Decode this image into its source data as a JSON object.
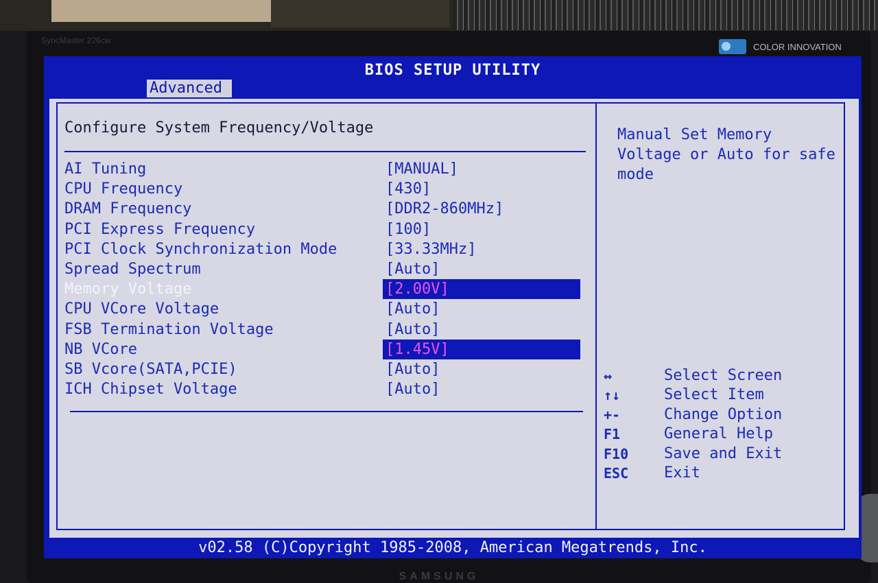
{
  "monitor": {
    "model": "SyncMaster 226cw",
    "badge": "COLOR INNOVATION",
    "brand": "SAMSUNG"
  },
  "bios": {
    "title": "BIOS SETUP UTILITY",
    "active_tab": "Advanced",
    "heading": "Configure System Frequency/Voltage",
    "settings": [
      {
        "label": "AI Tuning",
        "value": "[MANUAL]"
      },
      {
        "label": "CPU Frequency",
        "value": "[430]"
      },
      {
        "label": "DRAM Frequency",
        "value": "[DDR2-860MHz]"
      },
      {
        "label": "PCI Express Frequency",
        "value": "[100]"
      },
      {
        "label": "PCI Clock Synchronization Mode",
        "value": "[33.33MHz]"
      },
      {
        "label": "Spread Spectrum",
        "value": "[Auto]"
      },
      {
        "label": "Memory Voltage",
        "value": "[2.00V]"
      },
      {
        "label": "CPU VCore Voltage",
        "value": "[Auto]"
      },
      {
        "label": "FSB Termination Voltage",
        "value": "[Auto]"
      },
      {
        "label": "NB VCore",
        "value": "[1.45V]"
      },
      {
        "label": "SB Vcore(SATA,PCIE)",
        "value": "[Auto]"
      },
      {
        "label": "ICH Chipset Voltage",
        "value": "[Auto]"
      }
    ],
    "help_text": "Manual Set Memory Voltage or Auto for safe mode",
    "keys": [
      {
        "key": "↔",
        "desc": "Select Screen"
      },
      {
        "key": "↑↓",
        "desc": "Select Item"
      },
      {
        "key": "+-",
        "desc": "Change Option"
      },
      {
        "key": "F1",
        "desc": "General Help"
      },
      {
        "key": "F10",
        "desc": "Save and Exit"
      },
      {
        "key": "ESC",
        "desc": "Exit"
      }
    ],
    "footer": "v02.58 (C)Copyright 1985-2008, American Megatrends, Inc.",
    "colors": {
      "bios_blue": "#0d18b6",
      "panel_gray": "#d7d8e3",
      "highlight_magenta": "#f251ea",
      "selected_text": "#f4f4ff"
    }
  }
}
